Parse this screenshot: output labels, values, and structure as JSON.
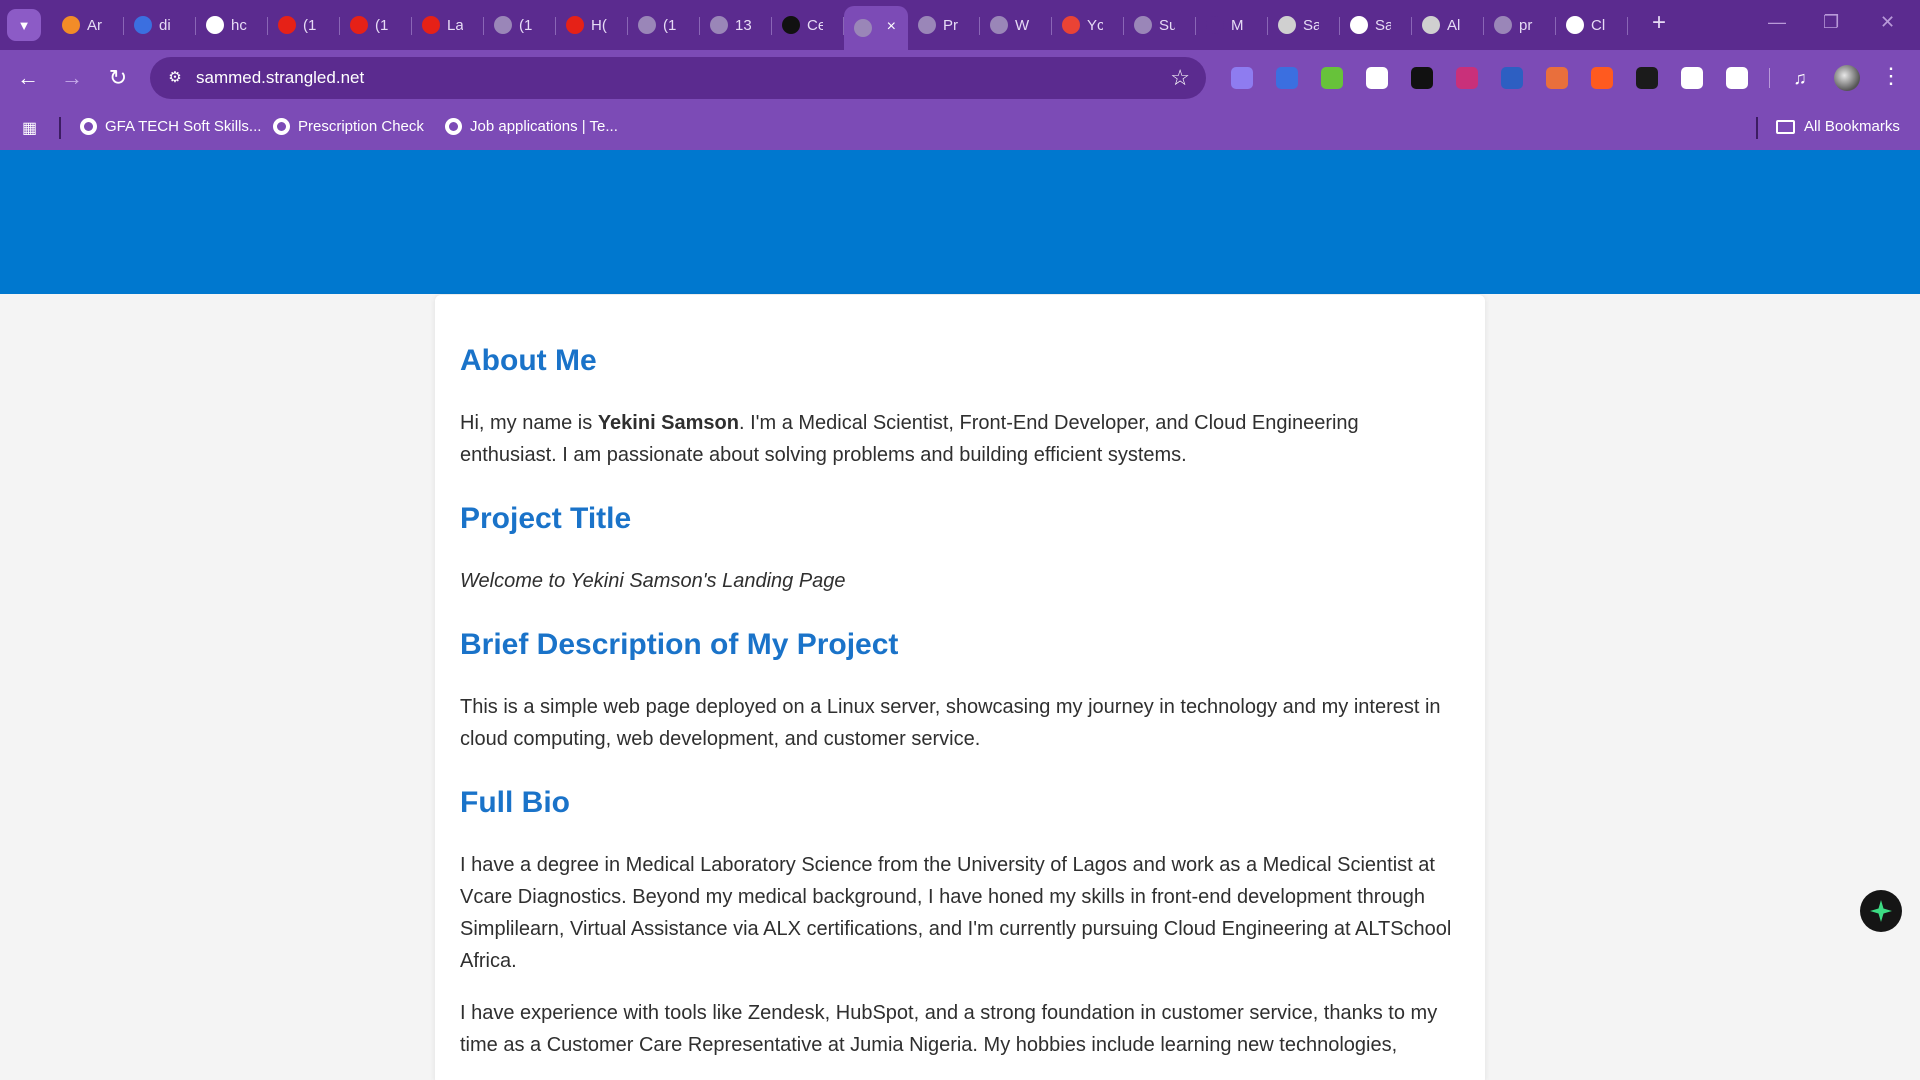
{
  "browser": {
    "tabs": [
      {
        "label": "Ar",
        "color": "#f28c28"
      },
      {
        "label": "di",
        "color": "#3b6fe0"
      },
      {
        "label": "hc",
        "color": "#ffffff"
      },
      {
        "label": "(1",
        "color": "#e62117"
      },
      {
        "label": "(1",
        "color": "#e62117"
      },
      {
        "label": "La",
        "color": "#e62117"
      },
      {
        "label": "(1",
        "color": "#9a86b8"
      },
      {
        "label": "H(",
        "color": "#e62117"
      },
      {
        "label": "(1",
        "color": "#9a86b8"
      },
      {
        "label": "13",
        "color": "#9a86b8"
      },
      {
        "label": "Ce",
        "color": "#111111"
      },
      {
        "label": "",
        "color": "#9a86b8",
        "active": true
      },
      {
        "label": "Pr",
        "color": "#9a86b8"
      },
      {
        "label": "W",
        "color": "#9a86b8"
      },
      {
        "label": "Yc",
        "color": "#ea4335"
      },
      {
        "label": "Su",
        "color": "#9a86b8"
      },
      {
        "label": "M",
        "color": "#5b2b8f"
      },
      {
        "label": "Sa",
        "color": "#d0d0d0"
      },
      {
        "label": "Sa",
        "color": "#ffffff"
      },
      {
        "label": "Al",
        "color": "#d0d0d0"
      },
      {
        "label": "pr",
        "color": "#9a86b8"
      },
      {
        "label": "Cl",
        "color": "#ffffff"
      }
    ],
    "active_tab_close": "×",
    "new_tab": "+",
    "window_controls": {
      "minimize": "—",
      "restore": "❐",
      "close": "✕"
    },
    "url": "sammed.strangled.net",
    "extensions": [
      "#8e7cf0",
      "#3b6fe0",
      "#67c23a",
      "#ffffff",
      "#111111",
      "#c9307a",
      "#2d5fc2",
      "#e96f3c",
      "#ff5a1f",
      "#1b1b1b",
      "#ffffff",
      "#ffffff"
    ],
    "bookmarks": [
      {
        "label": "GFA TECH Soft Skills..."
      },
      {
        "label": "Prescription Check"
      },
      {
        "label": "Job applications | Te..."
      }
    ],
    "all_bookmarks": "All Bookmarks"
  },
  "page": {
    "about_heading": "About Me",
    "about_intro": "Hi, my name is ",
    "about_name": "Yekini Samson",
    "about_rest": ". I'm a Medical Scientist, Front-End Developer, and Cloud Engineering enthusiast. I am passionate about solving problems and building efficient systems.",
    "project_heading": "Project Title",
    "project_title": "Welcome to Yekini Samson's Landing Page",
    "desc_heading": "Brief Description of My Project",
    "desc_text": "This is a simple web page deployed on a Linux server, showcasing my journey in technology and my interest in cloud computing, web development, and customer service.",
    "bio_heading": "Full Bio",
    "bio_p1": "I have a degree in Medical Laboratory Science from the University of Lagos and work as a Medical Scientist at Vcare Diagnostics. Beyond my medical background, I have honed my skills in front-end development through Simplilearn, Virtual Assistance via ALX certifications, and I'm currently pursuing Cloud Engineering at ALTSchool Africa.",
    "bio_p2": "I have experience with tools like Zendesk, HubSpot, and a strong foundation in customer service, thanks to my time as a Customer Care Representative at Jumia Nigeria. My hobbies include learning new technologies,"
  },
  "colors": {
    "hero": "#0078cf",
    "heading": "#1a73c9",
    "chrome": "#7c4bb6"
  }
}
